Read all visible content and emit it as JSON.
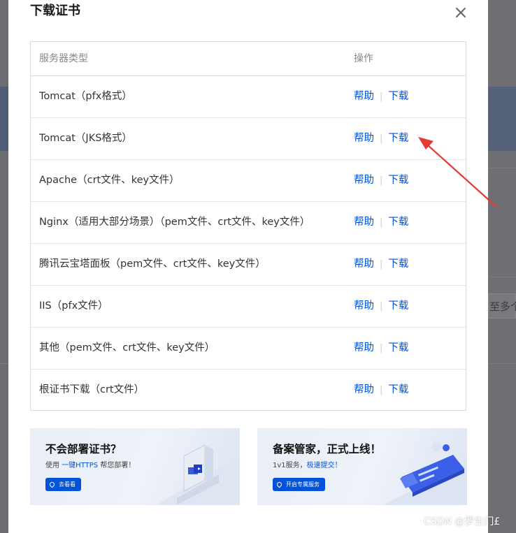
{
  "dialog": {
    "title": "下载证书",
    "close_icon": "close-icon"
  },
  "table": {
    "headers": {
      "type": "服务器类型",
      "action": "操作"
    },
    "rows": [
      {
        "type": "Tomcat（pfx格式）",
        "help": "帮助",
        "download": "下载"
      },
      {
        "type": "Tomcat（JKS格式）",
        "help": "帮助",
        "download": "下载"
      },
      {
        "type": "Apache（crt文件、key文件）",
        "help": "帮助",
        "download": "下载"
      },
      {
        "type": "Nginx（适用大部分场景）（pem文件、crt文件、key文件）",
        "help": "帮助",
        "download": "下载"
      },
      {
        "type": "腾讯云宝塔面板（pem文件、crt文件、key文件）",
        "help": "帮助",
        "download": "下载"
      },
      {
        "type": "IIS（pfx文件）",
        "help": "帮助",
        "download": "下载"
      },
      {
        "type": "其他（pem文件、crt文件、key文件）",
        "help": "帮助",
        "download": "下载"
      },
      {
        "type": "根证书下载（crt文件）",
        "help": "帮助",
        "download": "下载"
      }
    ]
  },
  "banners": [
    {
      "title": "不会部署证书？",
      "sub_prefix": "使用",
      "sub_highlight": "一键HTTPS",
      "sub_suffix": "帮您部署！",
      "button": "去看看"
    },
    {
      "title": "备案管家，正式上线！",
      "sub_prefix": "1v1服务，",
      "sub_highlight": "极速提交！",
      "sub_suffix": "",
      "button": "开启专属服务"
    }
  ],
  "background": {
    "partial_text": "至多个"
  },
  "watermark": "CSDN @罗生门£",
  "colors": {
    "link": "#0052d9",
    "arrow": "#e53935",
    "overlay": "#5a5d63"
  }
}
